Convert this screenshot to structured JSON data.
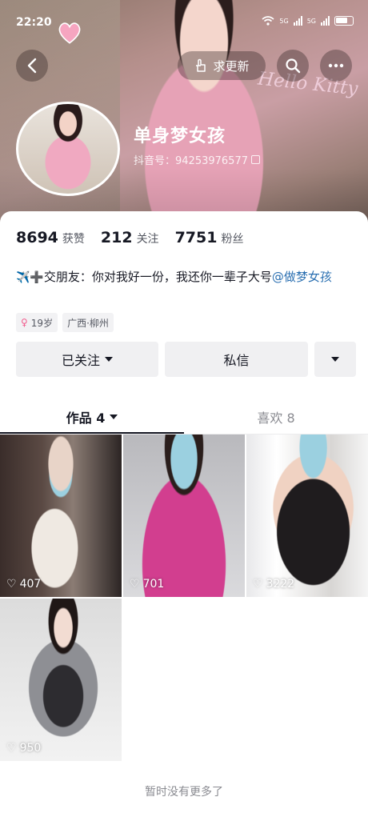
{
  "status_bar": {
    "time": "22:20",
    "network_1": "5G",
    "network_2": "5G"
  },
  "header": {
    "update_label": "求更新",
    "banner_text": "Hello Kitty",
    "nickname": "单身梦女孩",
    "douyin_id": "抖音号：94253976577"
  },
  "stats": {
    "likes_count": "8694",
    "likes_label": "获赞",
    "following_count": "212",
    "following_label": "关注",
    "followers_count": "7751",
    "followers_label": "粉丝"
  },
  "bio": {
    "emoji": "✈️➕",
    "text": "交朋友：你对我好一份，我还你一辈子大号",
    "mention": "@做梦女孩"
  },
  "tags": {
    "age": "19岁",
    "location": "广西·柳州"
  },
  "actions": {
    "follow_label": "已关注",
    "message_label": "私信"
  },
  "tabs": {
    "works_label": "作品 4",
    "likes_label": "喜欢 8"
  },
  "videos": [
    {
      "likes": "407"
    },
    {
      "likes": "701"
    },
    {
      "likes": "3222"
    },
    {
      "likes": "950"
    }
  ],
  "footer": {
    "no_more": "暂时没有更多了"
  },
  "colors": {
    "mention": "#2a6fb1",
    "gender": "#f25d8e",
    "button_bg": "#f0f0f2"
  }
}
